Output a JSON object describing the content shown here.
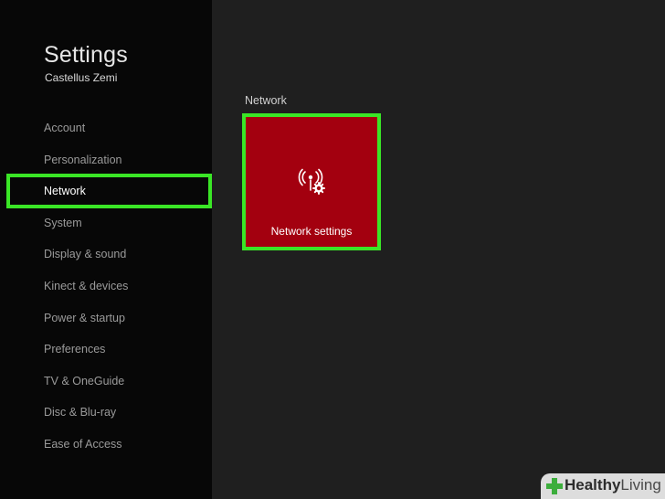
{
  "sidebar": {
    "title": "Settings",
    "user": "Castellus Zemi",
    "items": [
      {
        "label": "Account"
      },
      {
        "label": "Personalization"
      },
      {
        "label": "Network",
        "active": true
      },
      {
        "label": "System"
      },
      {
        "label": "Display & sound"
      },
      {
        "label": "Kinect & devices"
      },
      {
        "label": "Power & startup"
      },
      {
        "label": "Preferences"
      },
      {
        "label": "TV & OneGuide"
      },
      {
        "label": "Disc & Blu-ray"
      },
      {
        "label": "Ease of Access"
      }
    ]
  },
  "main": {
    "section_label": "Network",
    "tile": {
      "label": "Network settings",
      "icon": "wireless-gear-icon",
      "color": "#a3000f"
    }
  },
  "highlight_color": "#3ae626",
  "watermark": {
    "brand_bold": "Healthy",
    "brand_light": "Living",
    "logo_color": "#3cae3c"
  }
}
